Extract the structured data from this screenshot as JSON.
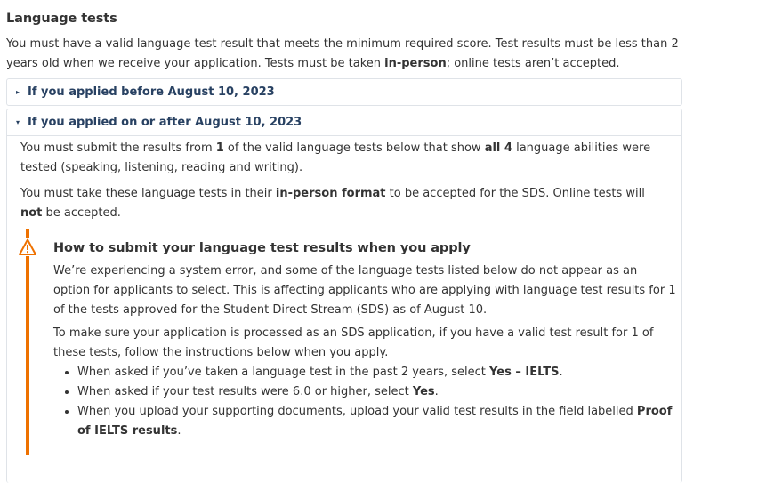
{
  "heading": "Language tests",
  "intro": {
    "part1": "You must have a valid language test result that meets the minimum required score. Test results must be less than 2 years old when we receive your application. Tests must be taken ",
    "bold1": "in-person",
    "part2": "; online tests aren’t accepted."
  },
  "details_closed": {
    "marker": "▸",
    "label": "If you applied before August 10, 2023"
  },
  "details_open": {
    "marker": "▾",
    "label": "If you applied on or after August 10, 2023",
    "para1": {
      "a": "You must submit the results from ",
      "b": "1",
      "c": " of the valid language tests below that show ",
      "d": "all 4",
      "e": " language abilities were tested (speaking, listening, reading and writing)."
    },
    "para2": {
      "a": "You must take these language tests in their ",
      "b": "in-person format",
      "c": " to be accepted for the SDS. Online tests will ",
      "d": "not",
      "e": " be accepted."
    }
  },
  "alert": {
    "icon": "warning-icon",
    "accent_color": "#ee7100",
    "title": "How to submit your language test results when you apply",
    "para1": "We’re experiencing a system error, and some of the language tests listed below do not appear as an option for applicants to select. This is affecting applicants who are applying with language test results for 1 of the tests approved for the Student Direct Stream (SDS) as of August 10.",
    "para2": "To make sure your application is processed as an SDS application, if you have a valid test result for 1 of these tests, follow the instructions below when you apply.",
    "bullets": [
      {
        "text": "When asked if you’ve taken a language test in the past 2 years, select ",
        "bold": "Yes – IELTS",
        "tail": "."
      },
      {
        "text": "When asked if your test results were 6.0 or higher, select ",
        "bold": "Yes",
        "tail": "."
      },
      {
        "text": "When you upload your supporting documents, upload your valid test results in the field labelled ",
        "bold": "Proof of IELTS results",
        "tail": "."
      }
    ]
  },
  "colors": {
    "link": "#284162",
    "border": "#dfe3e8",
    "text": "#333333"
  }
}
